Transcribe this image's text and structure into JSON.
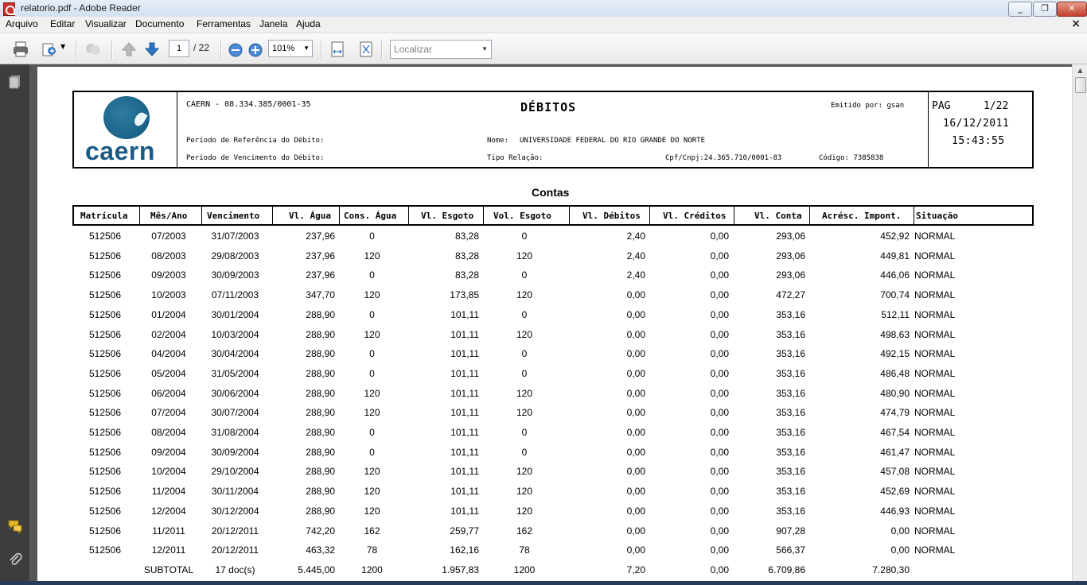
{
  "window": {
    "title": "relatorio.pdf - Adobe Reader"
  },
  "menu": [
    "Arquivo",
    "Editar",
    "Visualizar",
    "Documento",
    "Ferramentas",
    "Janela",
    "Ajuda"
  ],
  "toolbar": {
    "page_current": "1",
    "page_total": "/ 22",
    "zoom": "101%",
    "find_placeholder": "Localizar"
  },
  "icons": {
    "print": "print-icon",
    "share": "share-icon",
    "prev_page": "arrow-up-icon",
    "next_page": "arrow-down-icon",
    "zoom_out": "zoom-out-icon",
    "zoom_in": "zoom-in-icon",
    "fit_width": "fit-width-icon",
    "fit_page": "fit-page-icon",
    "pages_panel": "pages-icon",
    "comments": "comment-icon",
    "attachments": "paperclip-icon"
  },
  "report": {
    "logo_text": "caern",
    "company": "CAERN - 08.334.385/0001-35",
    "title": "DÉBITOS",
    "issued_by": "Emitido por: gsan",
    "page_label": "PAG",
    "page_num": "1/22",
    "date": "16/12/2011",
    "time": "15:43:55",
    "ref_period": "Período de Referência do Débito:",
    "due_period": "Período de Vencimento do Débito:",
    "name_label": "Nome:",
    "name_value": "UNIVERSIDADE FEDERAL DO RIO GRANDE DO NORTE",
    "relation_label": "Tipo Relação:",
    "cpf": "Cpf/Cnpj:24.365.710/0001-83",
    "code": "Código: 7385838",
    "section": "Contas",
    "columns": [
      "Matrícula",
      "Mês/Ano",
      "Vencimento",
      "Vl. Água",
      "Cons. Água",
      "Vl. Esgoto",
      "Vol. Esgoto",
      "Vl. Débitos",
      "Vl. Créditos",
      "Vl. Conta",
      "Acrésc. Impont.",
      "Situação"
    ],
    "rows": [
      [
        "512506",
        "07/2003",
        "31/07/2003",
        "237,96",
        "0",
        "83,28",
        "0",
        "2,40",
        "0,00",
        "293,06",
        "452,92",
        "NORMAL"
      ],
      [
        "512506",
        "08/2003",
        "29/08/2003",
        "237,96",
        "120",
        "83,28",
        "120",
        "2,40",
        "0,00",
        "293,06",
        "449,81",
        "NORMAL"
      ],
      [
        "512506",
        "09/2003",
        "30/09/2003",
        "237,96",
        "0",
        "83,28",
        "0",
        "2,40",
        "0,00",
        "293,06",
        "446,06",
        "NORMAL"
      ],
      [
        "512506",
        "10/2003",
        "07/11/2003",
        "347,70",
        "120",
        "173,85",
        "120",
        "0,00",
        "0,00",
        "472,27",
        "700,74",
        "NORMAL"
      ],
      [
        "512506",
        "01/2004",
        "30/01/2004",
        "288,90",
        "0",
        "101,11",
        "0",
        "0,00",
        "0,00",
        "353,16",
        "512,11",
        "NORMAL"
      ],
      [
        "512506",
        "02/2004",
        "10/03/2004",
        "288,90",
        "120",
        "101,11",
        "120",
        "0,00",
        "0,00",
        "353,16",
        "498,63",
        "NORMAL"
      ],
      [
        "512506",
        "04/2004",
        "30/04/2004",
        "288,90",
        "0",
        "101,11",
        "0",
        "0,00",
        "0,00",
        "353,16",
        "492,15",
        "NORMAL"
      ],
      [
        "512506",
        "05/2004",
        "31/05/2004",
        "288,90",
        "0",
        "101,11",
        "0",
        "0,00",
        "0,00",
        "353,16",
        "486,48",
        "NORMAL"
      ],
      [
        "512506",
        "06/2004",
        "30/06/2004",
        "288,90",
        "120",
        "101,11",
        "120",
        "0,00",
        "0,00",
        "353,16",
        "480,90",
        "NORMAL"
      ],
      [
        "512506",
        "07/2004",
        "30/07/2004",
        "288,90",
        "120",
        "101,11",
        "120",
        "0,00",
        "0,00",
        "353,16",
        "474,79",
        "NORMAL"
      ],
      [
        "512506",
        "08/2004",
        "31/08/2004",
        "288,90",
        "0",
        "101,11",
        "0",
        "0,00",
        "0,00",
        "353,16",
        "467,54",
        "NORMAL"
      ],
      [
        "512506",
        "09/2004",
        "30/09/2004",
        "288,90",
        "0",
        "101,11",
        "0",
        "0,00",
        "0,00",
        "353,16",
        "461,47",
        "NORMAL"
      ],
      [
        "512506",
        "10/2004",
        "29/10/2004",
        "288,90",
        "120",
        "101,11",
        "120",
        "0,00",
        "0,00",
        "353,16",
        "457,08",
        "NORMAL"
      ],
      [
        "512506",
        "11/2004",
        "30/11/2004",
        "288,90",
        "120",
        "101,11",
        "120",
        "0,00",
        "0,00",
        "353,16",
        "452,69",
        "NORMAL"
      ],
      [
        "512506",
        "12/2004",
        "30/12/2004",
        "288,90",
        "120",
        "101,11",
        "120",
        "0,00",
        "0,00",
        "353,16",
        "446,93",
        "NORMAL"
      ],
      [
        "512506",
        "11/2011",
        "20/12/2011",
        "742,20",
        "162",
        "259,77",
        "162",
        "0,00",
        "0,00",
        "907,28",
        "0,00",
        "NORMAL"
      ],
      [
        "512506",
        "12/2011",
        "20/12/2011",
        "463,32",
        "78",
        "162,16",
        "78",
        "0,00",
        "0,00",
        "566,37",
        "0,00",
        "NORMAL"
      ]
    ],
    "subtotal": {
      "label": "SUBTOTAL",
      "docs": "17 doc(s)",
      "agua": "5.445,00",
      "cons": "1200",
      "esgoto": "1.957,83",
      "vol": "1200",
      "debitos": "7,20",
      "creditos": "0,00",
      "conta": "6.709,86",
      "acresc": "7.280,30"
    }
  }
}
